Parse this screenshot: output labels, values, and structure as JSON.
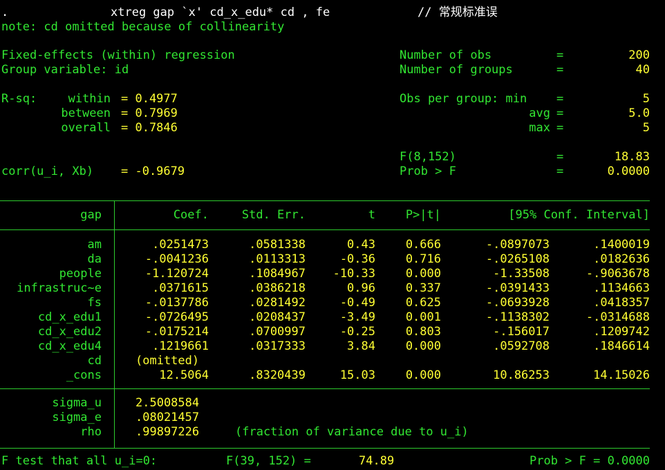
{
  "command": {
    "prompt": ".",
    "text": "xtreg gap `x' cd_x_edu* cd , fe",
    "comment": "// 常规标准误"
  },
  "note": "note: cd omitted because of collinearity",
  "header": {
    "model_title": "Fixed-effects (within) regression",
    "group_var": "Group variable: id",
    "rsq_label": "R-sq:",
    "within_label": "within",
    "within_value": "= 0.4977",
    "between_label": "between",
    "between_value": "= 0.7969",
    "overall_label": "overall",
    "overall_value": "= 0.7846",
    "corr_label": "corr(u_i, Xb)",
    "corr_value": "= -0.9679",
    "nobs_label": "Number of obs",
    "nobs_value": "200",
    "ngroups_label": "Number of groups",
    "ngroups_value": "40",
    "opg_label": "Obs per group: min",
    "opg_min": "5",
    "avg_label": "avg",
    "opg_avg": "5.0",
    "max_label": "max",
    "opg_max": "5",
    "f_label": "F(8,152)",
    "f_value": "18.83",
    "probf_label": "Prob > F",
    "probf_value": "0.0000",
    "eq": "="
  },
  "table": {
    "columns": [
      "gap",
      "Coef.",
      "Std. Err.",
      "t",
      "P>|t|",
      "[95% Conf. Interval]"
    ],
    "rows": [
      {
        "var": "am",
        "coef": ".0251473",
        "se": ".0581338",
        "t": "0.43",
        "p": "0.666",
        "lo": "-.0897073",
        "hi": ".1400019"
      },
      {
        "var": "da",
        "coef": "-.0041236",
        "se": ".0113313",
        "t": "-0.36",
        "p": "0.716",
        "lo": "-.0265108",
        "hi": ".0182636"
      },
      {
        "var": "people",
        "coef": "-1.120724",
        "se": ".1084967",
        "t": "-10.33",
        "p": "0.000",
        "lo": "-1.33508",
        "hi": "-.9063678"
      },
      {
        "var": "infrastruc~e",
        "coef": ".0371615",
        "se": ".0386218",
        "t": "0.96",
        "p": "0.337",
        "lo": "-.0391433",
        "hi": ".1134663"
      },
      {
        "var": "fs",
        "coef": "-.0137786",
        "se": ".0281492",
        "t": "-0.49",
        "p": "0.625",
        "lo": "-.0693928",
        "hi": ".0418357"
      },
      {
        "var": "cd_x_edu1",
        "coef": "-.0726495",
        "se": ".0208437",
        "t": "-3.49",
        "p": "0.001",
        "lo": "-.1138302",
        "hi": "-.0314688"
      },
      {
        "var": "cd_x_edu2",
        "coef": "-.0175214",
        "se": ".0700997",
        "t": "-0.25",
        "p": "0.803",
        "lo": "-.156017",
        "hi": ".1209742"
      },
      {
        "var": "cd_x_edu4",
        "coef": ".1219661",
        "se": ".0317333",
        "t": "3.84",
        "p": "0.000",
        "lo": ".0592708",
        "hi": ".1846614"
      },
      {
        "var": "cd",
        "coef": "(omitted)",
        "se": "",
        "t": "",
        "p": "",
        "lo": "",
        "hi": ""
      },
      {
        "var": "_cons",
        "coef": "12.5064",
        "se": ".8320439",
        "t": "15.03",
        "p": "0.000",
        "lo": "10.86253",
        "hi": "14.15026"
      }
    ],
    "sigma_u_label": "sigma_u",
    "sigma_u": "2.5008584",
    "sigma_e_label": "sigma_e",
    "sigma_e": ".08021457",
    "rho_label": "rho",
    "rho": ".99897226",
    "rho_note": "(fraction of variance due to u_i)"
  },
  "ftest": {
    "label": "F test that all u_i=0:",
    "stat_label": "F(39, 152) =",
    "stat_value": "74.89",
    "prob": "Prob > F = 0.0000"
  },
  "colors": {
    "background": "#000000",
    "text_white": "#ffffff",
    "text_green": "#32e632",
    "text_yellow": "#ffff33"
  }
}
